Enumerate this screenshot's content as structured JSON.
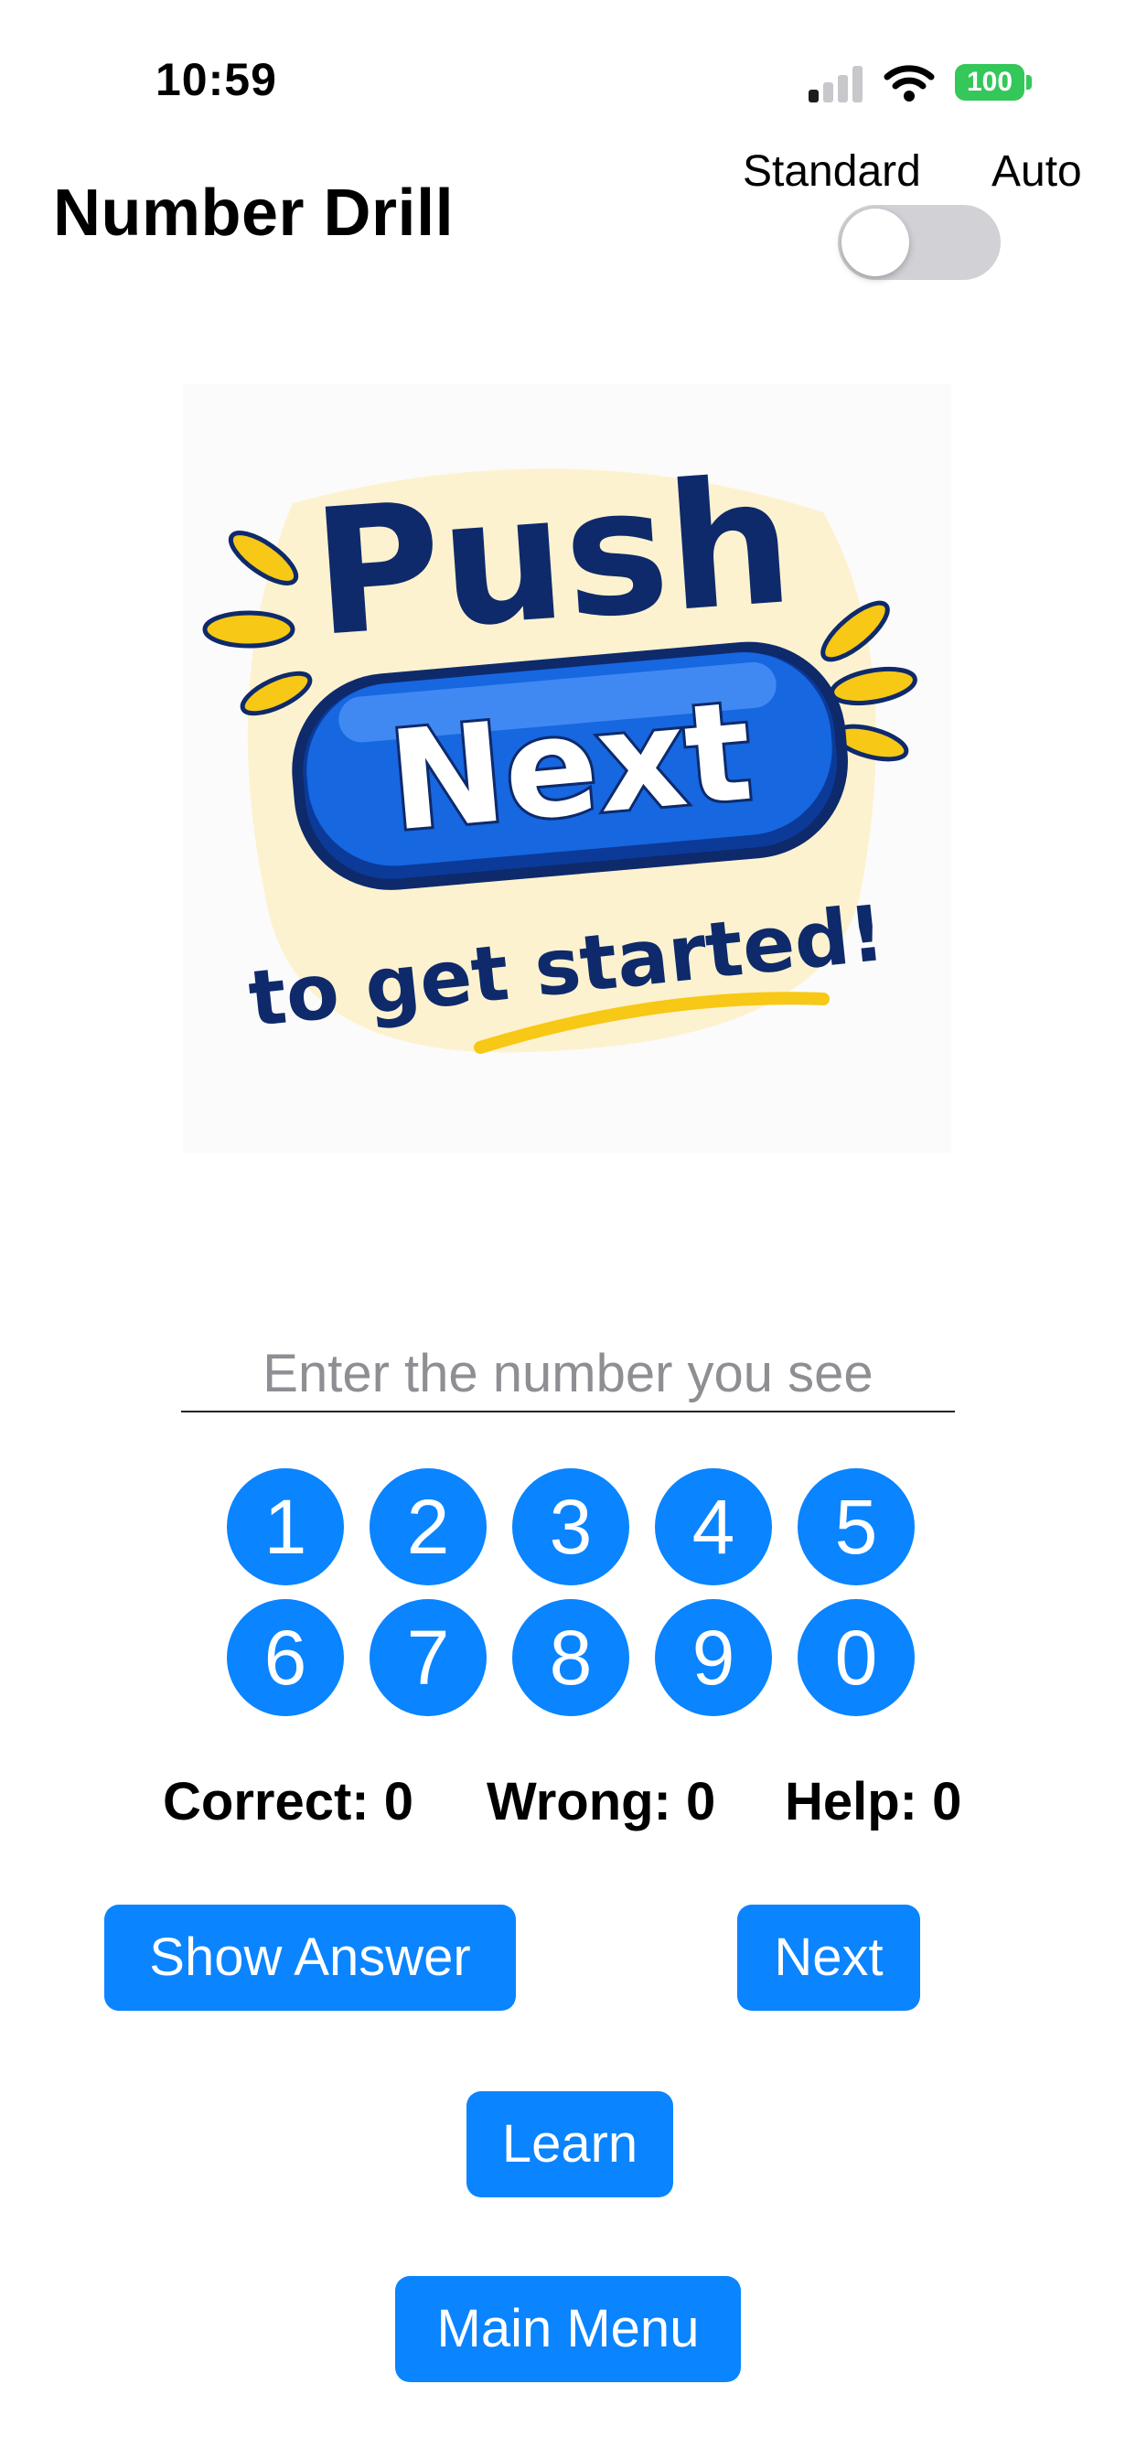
{
  "status_bar": {
    "time": "10:59",
    "battery": "100"
  },
  "header": {
    "title": "Number Drill",
    "mode_left": "Standard",
    "mode_right": "Auto",
    "auto_enabled": false
  },
  "illustration": {
    "line1": "Push",
    "line2": "Next",
    "line3": "to get started!"
  },
  "input": {
    "placeholder": "Enter the number you see",
    "value": ""
  },
  "keypad": {
    "row1": [
      "1",
      "2",
      "3",
      "4",
      "5"
    ],
    "row2": [
      "6",
      "7",
      "8",
      "9",
      "0"
    ]
  },
  "scores": {
    "correct": "Correct: 0",
    "wrong": "Wrong: 0",
    "help": "Help: 0"
  },
  "buttons": {
    "show_answer": "Show Answer",
    "next": "Next",
    "learn": "Learn",
    "main_menu": "Main Menu"
  },
  "colors": {
    "accent": "#0a84ff",
    "battery": "#34c759",
    "logo_navy": "#0e2a6b",
    "logo_yellow": "#f7c815"
  }
}
